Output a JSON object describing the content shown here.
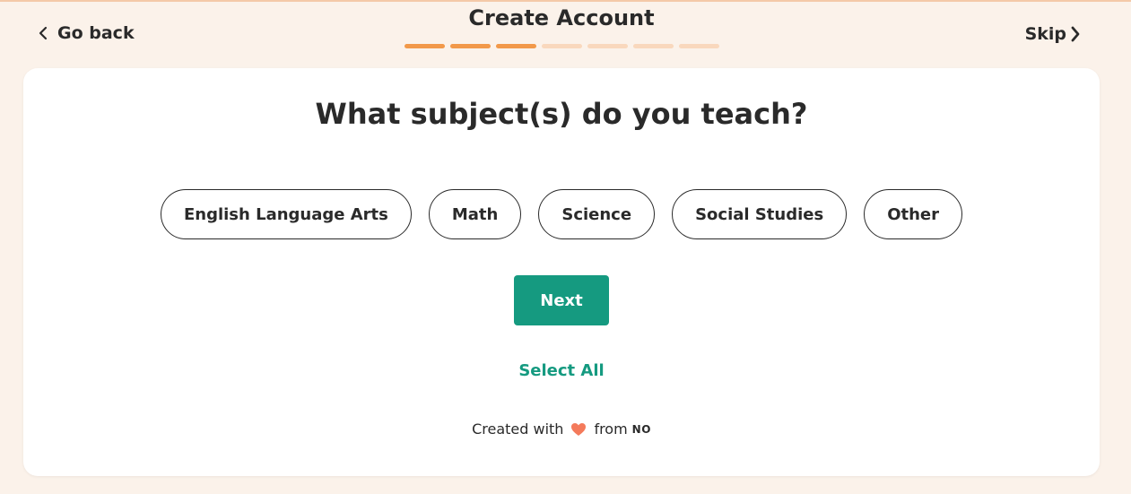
{
  "header": {
    "back_label": "Go back",
    "title": "Create Account",
    "skip_label": "Skip",
    "progress": {
      "completed_steps": 3,
      "total_steps": 7
    }
  },
  "question": "What subject(s) do you teach?",
  "subjects": [
    "English Language Arts",
    "Math",
    "Science",
    "Social Studies",
    "Other"
  ],
  "next_label": "Next",
  "select_all_label": "Select All",
  "footer": {
    "created_with": "Created with",
    "from": "from",
    "brand": "NO"
  },
  "colors": {
    "accent": "#159a80",
    "progress_done": "#f2994a",
    "progress_todo": "#f9d8bd",
    "background": "#fbf2ea",
    "heart": "#f47a5b"
  },
  "icons": {
    "back": "chevron-left-icon",
    "skip": "chevron-right-icon",
    "heart": "heart-icon"
  }
}
